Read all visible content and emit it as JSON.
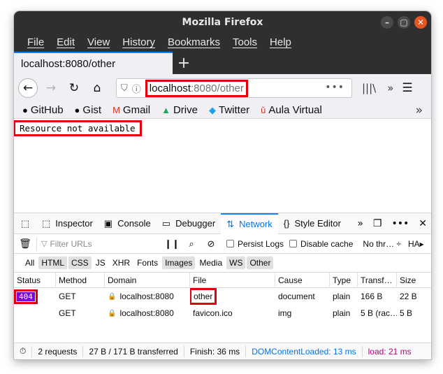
{
  "window": {
    "title": "Mozilla Firefox"
  },
  "menu": [
    "File",
    "Edit",
    "View",
    "History",
    "Bookmarks",
    "Tools",
    "Help"
  ],
  "tab": {
    "title": "localhost:8080/other",
    "new_tab": "+"
  },
  "nav": {
    "url_host": "localhost",
    "url_rest": ":8080/other",
    "page_actions": "•••"
  },
  "bookmarks": [
    {
      "label": "GitHub",
      "icon": "github-icon"
    },
    {
      "label": "Gist",
      "icon": "github-icon"
    },
    {
      "label": "Gmail",
      "icon": "gmail-icon"
    },
    {
      "label": "Drive",
      "icon": "drive-icon"
    },
    {
      "label": "Twitter",
      "icon": "twitter-icon"
    },
    {
      "label": "Aula Virtual",
      "icon": "university-icon"
    }
  ],
  "page": {
    "body_text": "Resource not available"
  },
  "devtools": {
    "tabs": [
      "Inspector",
      "Console",
      "Debugger",
      "Network",
      "Style Editor"
    ],
    "active_tab": "Network",
    "filter_placeholder": "Filter URLs",
    "persist_logs": "Persist Logs",
    "disable_cache": "Disable cache",
    "throttling": "No thr… ÷",
    "har": "HA▸",
    "type_filters": [
      "All",
      "HTML",
      "CSS",
      "JS",
      "XHR",
      "Fonts",
      "Images",
      "Media",
      "WS",
      "Other"
    ],
    "columns": [
      "Status",
      "Method",
      "Domain",
      "File",
      "Cause",
      "Type",
      "Transf…",
      "Size"
    ],
    "requests": [
      {
        "status": "404",
        "method": "GET",
        "domain": "localhost:8080",
        "file": "other",
        "cause": "document",
        "type": "plain",
        "transferred": "166 B",
        "size": "22 B"
      },
      {
        "status": "",
        "method": "GET",
        "domain": "localhost:8080",
        "file": "favicon.ico",
        "cause": "img",
        "type": "plain",
        "transferred": "5 B (rac…",
        "size": "5 B"
      }
    ],
    "statusbar": {
      "requests": "2 requests",
      "transferred": "27 B / 171 B transferred",
      "finish": "Finish: 36 ms",
      "dom_content_loaded": "DOMContentLoaded: 13 ms",
      "load": "load: 21 ms"
    }
  },
  "colors": {
    "highlight": "#e20010",
    "status_404_bg": "#8000d7",
    "accent": "#0a84ff"
  }
}
